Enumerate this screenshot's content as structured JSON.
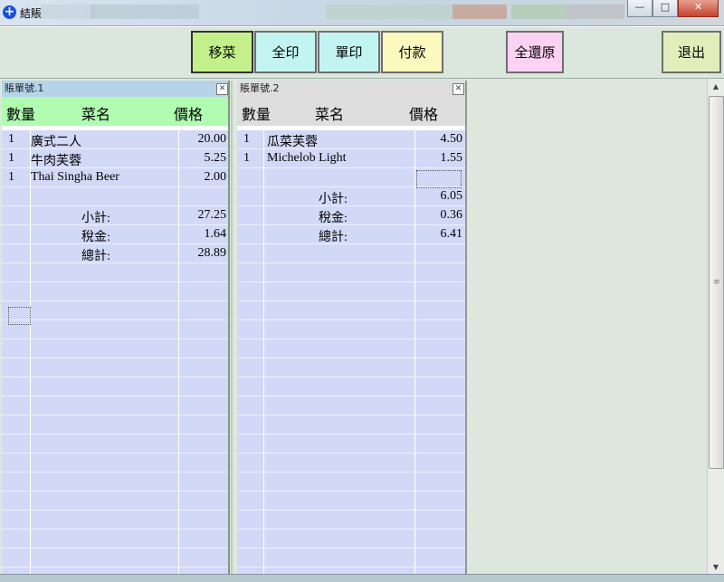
{
  "window": {
    "title": "結賬",
    "minimize_glyph": "—",
    "maximize_glyph": "□",
    "close_glyph": "✕",
    "icon": "plus-circle-icon"
  },
  "toolbar": {
    "move_item": "移菜",
    "print_all": "全印",
    "print_single": "單印",
    "pay": "付款",
    "restore_all": "全還原",
    "exit": "退出",
    "colors": {
      "move_item": "#c3f08a",
      "print": "#c2f5f2",
      "pay": "#fbf9be",
      "restore": "#fcd2f3",
      "exit": "#e1eebb"
    }
  },
  "bills": [
    {
      "title": "賬單號.1",
      "close_glyph": "✕",
      "header_color": "#b0fcb0",
      "columns": {
        "qty": "數量",
        "name": "菜名",
        "price": "價格"
      },
      "items": [
        {
          "qty": "1",
          "name": "廣式二人",
          "price": "20.00"
        },
        {
          "qty": "1",
          "name": "牛肉芙蓉",
          "price": "5.25"
        },
        {
          "qty": "1",
          "name": "Thai Singha Beer",
          "price": "2.00"
        }
      ],
      "totals": [
        {
          "label": "小計:",
          "value": "27.25"
        },
        {
          "label": "稅金:",
          "value": "1.64"
        },
        {
          "label": "總計:",
          "value": "28.89"
        }
      ]
    },
    {
      "title": "賬單號.2",
      "close_glyph": "✕",
      "header_color": "#dedede",
      "columns": {
        "qty": "數量",
        "name": "菜名",
        "price": "價格"
      },
      "items": [
        {
          "qty": "1",
          "name": "瓜菜芙蓉",
          "price": "4.50"
        },
        {
          "qty": "1",
          "name": "Michelob Light",
          "price": "1.55"
        }
      ],
      "totals": [
        {
          "label": "小計:",
          "value": "6.05"
        },
        {
          "label": "稅金:",
          "value": "0.36"
        },
        {
          "label": "總計:",
          "value": "6.41"
        }
      ]
    }
  ],
  "scrollbar": {
    "up_glyph": "▲",
    "down_glyph": "▼",
    "grip_glyph": "≡"
  }
}
